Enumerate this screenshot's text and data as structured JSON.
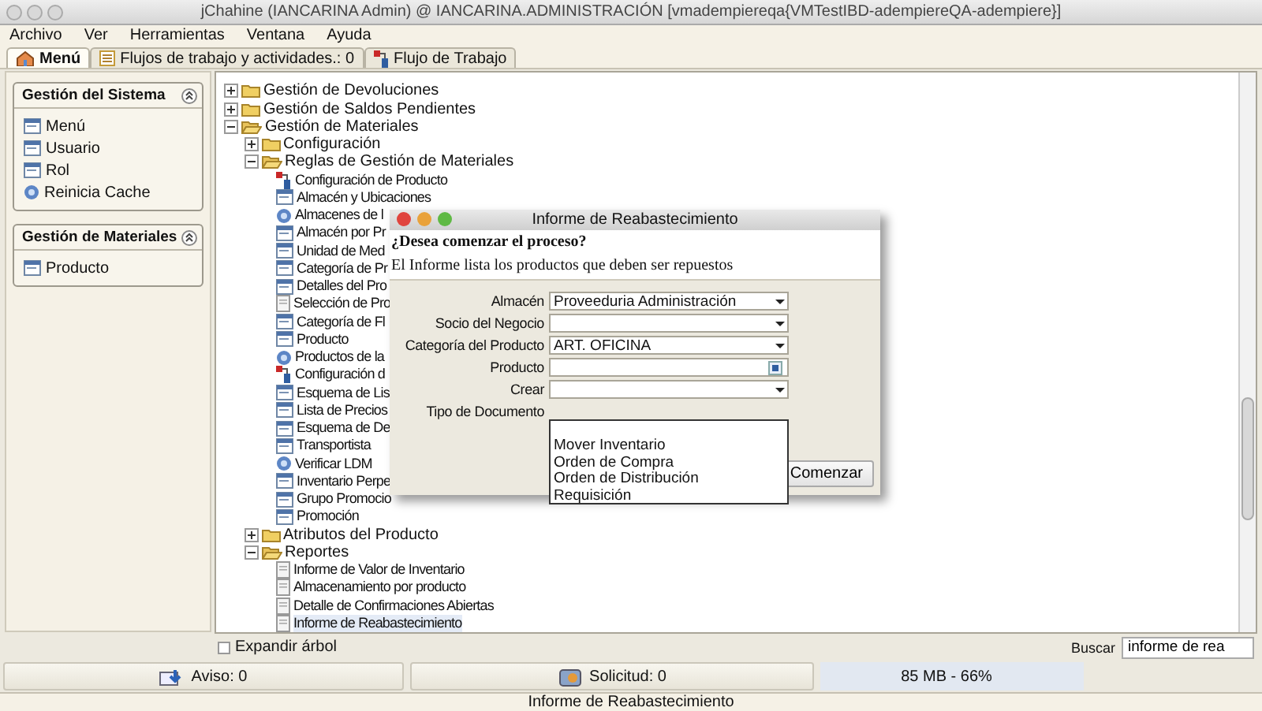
{
  "window": {
    "title": "jChahine (IANCARINA Admin) @ IANCARINA.ADMINISTRACIÓN [vmadempiereqa{VMTestIBD-adempiereQA-adempiere}]"
  },
  "menu": [
    "Archivo",
    "Ver",
    "Herramientas",
    "Ventana",
    "Ayuda"
  ],
  "tabs": [
    {
      "label": "Menú",
      "selected": true
    },
    {
      "label": "Flujos de trabajo y actividades.: 0",
      "selected": false
    },
    {
      "label": "Flujo de Trabajo",
      "selected": false
    }
  ],
  "sidebar": [
    {
      "title": "Gestión del Sistema",
      "expanded": true,
      "items": [
        {
          "label": "Menú",
          "kind": "window"
        },
        {
          "label": "Usuario",
          "kind": "window"
        },
        {
          "label": "Rol",
          "kind": "window"
        },
        {
          "label": "Reinicia Cache",
          "kind": "process"
        }
      ]
    },
    {
      "title": "Gestión de Materiales",
      "expanded": true,
      "items": [
        {
          "label": "Producto",
          "kind": "window"
        }
      ]
    }
  ],
  "tree": [
    {
      "label": "Gestión de Devoluciones",
      "expanded": false
    },
    {
      "label": "Gestión de Saldos Pendientes",
      "expanded": false
    },
    {
      "label": "Gestión de Materiales",
      "expanded": true,
      "children": [
        {
          "label": "Configuración",
          "expanded": false
        },
        {
          "label": "Reglas de Gestión de Materiales",
          "expanded": true,
          "children": [
            {
              "label": "Configuración de Producto",
              "kind": "workflow"
            },
            {
              "label": "Almacén y Ubicaciones",
              "kind": "window"
            },
            {
              "label": "Almacenes de l",
              "kind": "process"
            },
            {
              "label": "Almacén por Pr",
              "kind": "window"
            },
            {
              "label": "Unidad de Med",
              "kind": "window"
            },
            {
              "label": "Categoría de Pr",
              "kind": "window"
            },
            {
              "label": "Detalles del Pro",
              "kind": "window"
            },
            {
              "label": "Selección de Pro",
              "kind": "report"
            },
            {
              "label": "Categoría de Fl",
              "kind": "window"
            },
            {
              "label": "Producto",
              "kind": "window"
            },
            {
              "label": "Productos de la",
              "kind": "process"
            },
            {
              "label": "Configuración d",
              "kind": "workflow"
            },
            {
              "label": "Esquema de Lis",
              "kind": "window"
            },
            {
              "label": "Lista de Precios",
              "kind": "window"
            },
            {
              "label": "Esquema de De",
              "kind": "window"
            },
            {
              "label": "Transportista",
              "kind": "window"
            },
            {
              "label": "Verificar LDM",
              "kind": "process"
            },
            {
              "label": "Inventario Perpe",
              "kind": "window"
            },
            {
              "label": "Grupo Promocio",
              "kind": "window"
            },
            {
              "label": "Promoción",
              "kind": "window"
            }
          ]
        },
        {
          "label": "Atributos del Producto",
          "expanded": false
        },
        {
          "label": "Reportes",
          "expanded": true,
          "children": [
            {
              "label": "Informe de Valor de Inventario",
              "kind": "report"
            },
            {
              "label": "Almacenamiento por producto",
              "kind": "report"
            },
            {
              "label": "Detalle de Confirmaciones Abiertas",
              "kind": "report"
            },
            {
              "label": "Informe de Reabastecimiento",
              "kind": "report",
              "selected": true
            }
          ]
        }
      ]
    }
  ],
  "expand_tree": {
    "label": "Expandir árbol",
    "checked": false
  },
  "search": {
    "label": "Buscar",
    "value": "informe de rea"
  },
  "dialog": {
    "title": "Informe de Reabastecimiento",
    "question": "¿Desea comenzar el proceso?",
    "description": "El Informe lista los productos que deben ser repuestos",
    "fields": [
      {
        "label": "Almacén",
        "value": "Proveeduria Administración",
        "kind": "combo"
      },
      {
        "label": "Socio del Negocio",
        "kind": "combo"
      },
      {
        "label": "Categoría del Producto",
        "value": "ART. OFICINA",
        "kind": "combo"
      },
      {
        "label": "Producto",
        "kind": "search"
      },
      {
        "label": "Crear",
        "kind": "combo"
      },
      {
        "label": "Tipo de Documento",
        "kind": "label"
      }
    ],
    "open_list": [
      "Mover Inventario",
      "Orden de Compra",
      "Orden de Distribución",
      "Requisición"
    ],
    "button": "Comenzar"
  },
  "status_bar": {
    "notice": "Aviso: 0",
    "request": "Solicitud: 0",
    "memory": {
      "text": "85 MB - 66%",
      "level": 0.6
    }
  },
  "footer": "Informe de Reabastecimiento"
}
